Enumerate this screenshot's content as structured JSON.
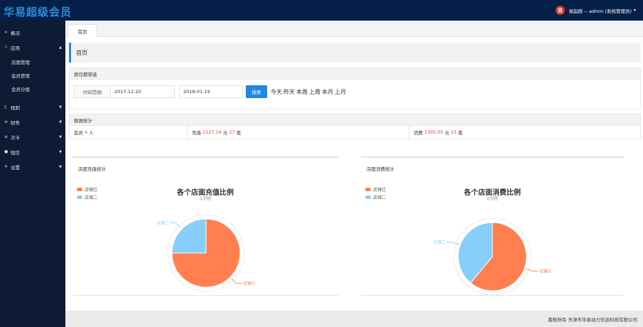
{
  "brand": "华易超级会员",
  "user": {
    "avatar_text": "消",
    "label": "易起群 -- admin (系统管理员)",
    "caret": "▾"
  },
  "sidebar": {
    "items": [
      {
        "label": "概况",
        "icon": "share-icon",
        "glyph": "<"
      },
      {
        "label": "应用",
        "icon": "star-icon",
        "glyph": "☆",
        "arrow": "▲"
      },
      {
        "label": "店面管理"
      },
      {
        "label": "会员管理"
      },
      {
        "label": "会员分组"
      },
      {
        "label": "规则",
        "icon": "book-icon",
        "glyph": "▯",
        "arrow": "▼"
      },
      {
        "label": "财务",
        "icon": "money-icon",
        "glyph": "≡",
        "arrow": "▼"
      },
      {
        "label": "次卡",
        "icon": "card-icon",
        "glyph": "≡",
        "arrow": "▼"
      },
      {
        "label": "短信",
        "icon": "message-icon",
        "glyph": "●",
        "arrow": "▼"
      },
      {
        "label": "设置",
        "icon": "tools-icon",
        "glyph": "✕",
        "arrow": "▼"
      }
    ]
  },
  "tabs": [
    {
      "label": "首页"
    }
  ],
  "page_title": "首页",
  "filter": {
    "heading": "按日期筛选",
    "range_label": "时间范围",
    "start_date": "2017-12-20",
    "end_date": "2018-01-19",
    "search_label": "搜索",
    "quick": [
      "今天",
      "昨天",
      "本周",
      "上周",
      "本月",
      "上月"
    ]
  },
  "stats": {
    "heading": "数据统计",
    "member_prefix": "会员",
    "member_count": "4",
    "member_unit": "人",
    "recharge_prefix": "充值",
    "recharge_amount": "2127.16",
    "recharge_unit": "元",
    "recharge_count": "27",
    "recharge_count_unit": "笔",
    "consume_prefix": "消费",
    "consume_amount": "1305.05",
    "consume_unit": "元",
    "consume_count": "23",
    "consume_count_unit": "笔"
  },
  "charts": [
    {
      "panel_label": "店面充值统计",
      "title": "各个店面充值比例",
      "subtitle": "比例图",
      "legend": [
        "店铺已",
        "店铺二"
      ],
      "slice_labels": [
        "店铺二",
        "店铺已"
      ]
    },
    {
      "panel_label": "店面消费统计",
      "title": "各个店面消费比例",
      "subtitle": "比例图",
      "legend": [
        "店铺已",
        "店铺二"
      ],
      "slice_labels": [
        "店铺二",
        "店铺已"
      ]
    }
  ],
  "chart_data": [
    {
      "type": "pie",
      "title": "各个店面充值比例",
      "subtitle": "比例图",
      "categories": [
        "店铺已",
        "店铺二"
      ],
      "values": [
        0.75,
        0.25
      ],
      "colors": [
        "#ff7f50",
        "#87cefa"
      ]
    },
    {
      "type": "pie",
      "title": "各个店面消费比例",
      "subtitle": "比例图",
      "categories": [
        "店铺已",
        "店铺二"
      ],
      "values": [
        0.61,
        0.39
      ],
      "colors": [
        "#ff7f50",
        "#87cefa"
      ]
    }
  ],
  "footer": "版权所有 天津市华易动力信息科技有限公司",
  "colors": {
    "topbar": "#052048",
    "sidebar": "#0d1b34",
    "accent": "#1e88e5",
    "highlight": "#e53935",
    "series_1": "#ff7f50",
    "series_2": "#87cefa"
  }
}
